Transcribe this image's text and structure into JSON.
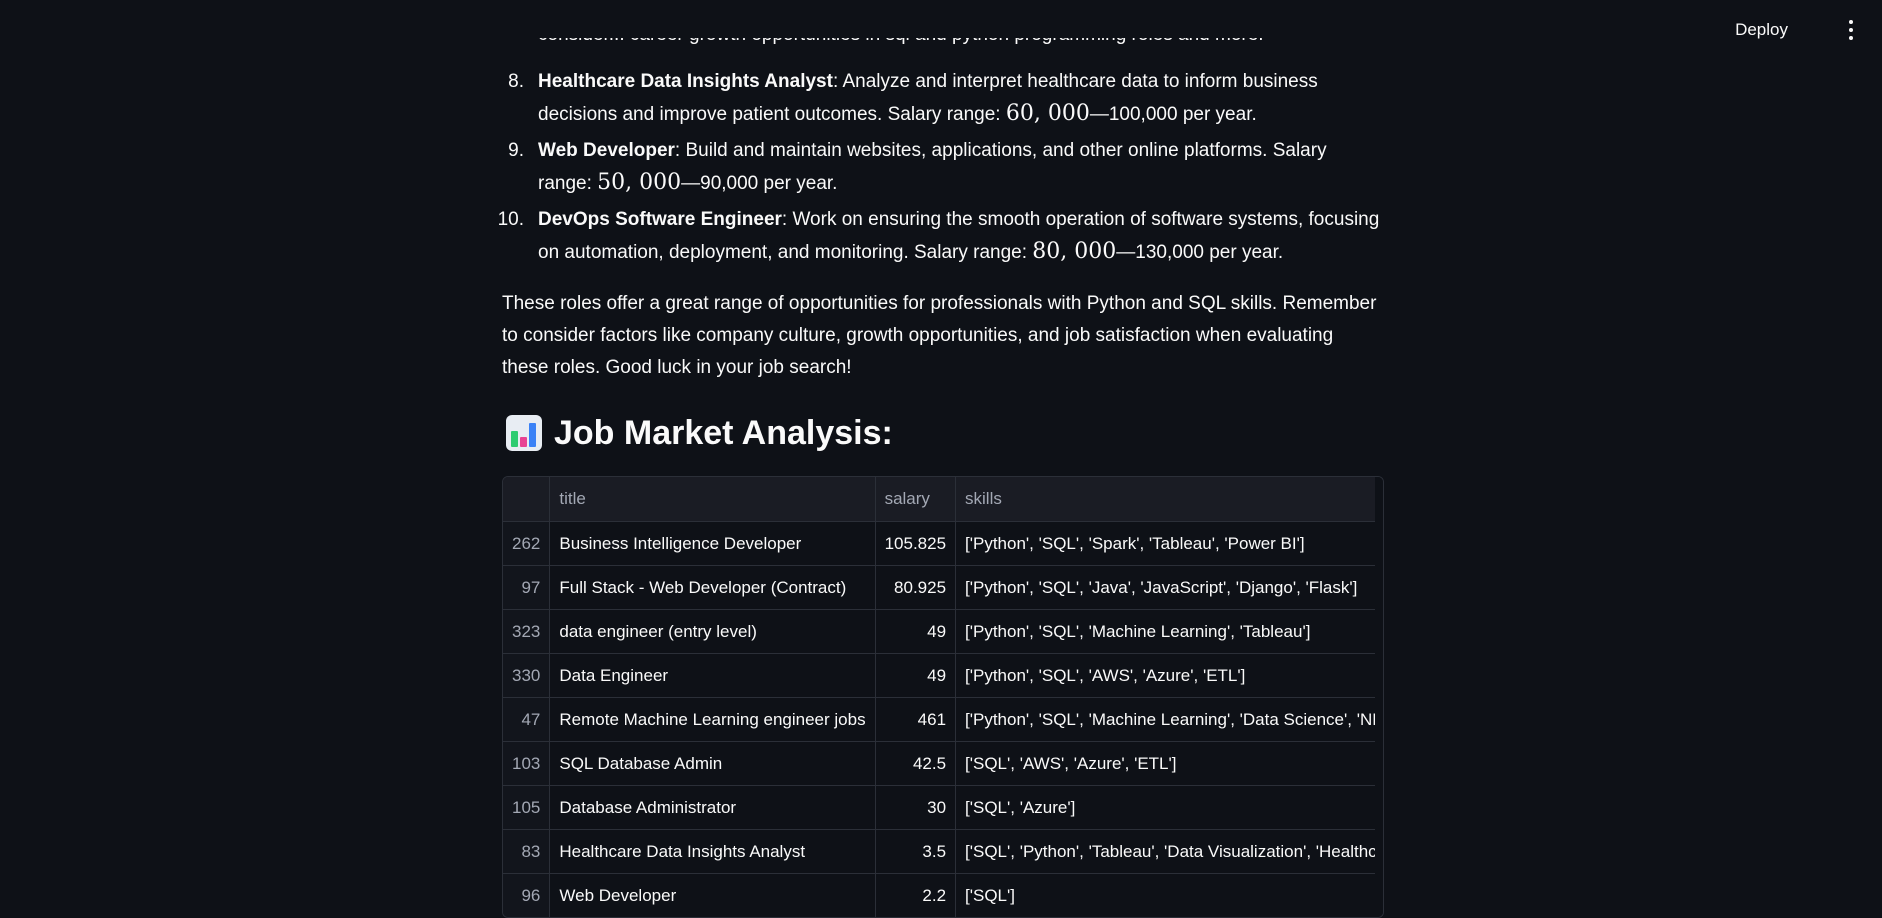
{
  "header": {
    "deploy_label": "Deploy"
  },
  "intro_cutoff_text": "consider... career growth opportunities in sql and python programming roles and more.",
  "roles": [
    {
      "number": "8.",
      "title": "Healthcare Data Insights Analyst",
      "desc": ": Analyze and interpret healthcare data to inform business decisions and improve patient outcomes. Salary range: ",
      "math": "60, 000",
      "tail": "—100,000 per year."
    },
    {
      "number": "9.",
      "title": "Web Developer",
      "desc": ": Build and maintain websites, applications, and other online platforms. Salary range: ",
      "math": "50, 000",
      "tail": "—90,000 per year."
    },
    {
      "number": "10.",
      "title": "DevOps Software Engineer",
      "desc": ": Work on ensuring the smooth operation of software systems, focusing on automation, deployment, and monitoring. Salary range: ",
      "math": "80, 000",
      "tail": "—130,000 per year."
    }
  ],
  "closing_paragraph": "These roles offer a great range of opportunities for professionals with Python and SQL skills. Remember to consider factors like company culture, growth opportunities, and job satisfaction when evaluating these roles. Good luck in your job search!",
  "section": {
    "icon": "bar-chart-icon",
    "title": "Job Market Analysis:"
  },
  "table": {
    "columns": [
      "",
      "title",
      "salary",
      "skills"
    ],
    "rows": [
      {
        "index": "262",
        "title": "Business Intelligence Developer",
        "salary": "105.825",
        "skills": "['Python', 'SQL', 'Spark', 'Tableau', 'Power BI']"
      },
      {
        "index": "97",
        "title": "Full Stack - Web Developer (Contract)",
        "salary": "80.925",
        "skills": "['Python', 'SQL', 'Java', 'JavaScript', 'Django', 'Flask']"
      },
      {
        "index": "323",
        "title": "data engineer (entry level)",
        "salary": "49",
        "skills": "['Python', 'SQL', 'Machine Learning', 'Tableau']"
      },
      {
        "index": "330",
        "title": "Data Engineer",
        "salary": "49",
        "skills": "['Python', 'SQL', 'AWS', 'Azure', 'ETL']"
      },
      {
        "index": "47",
        "title": "Remote Machine Learning engineer jobs",
        "salary": "461",
        "skills": "['Python', 'SQL', 'Machine Learning', 'Data Science', 'NLP']"
      },
      {
        "index": "103",
        "title": "SQL Database Admin",
        "salary": "42.5",
        "skills": "['SQL', 'AWS', 'Azure', 'ETL']"
      },
      {
        "index": "105",
        "title": "Database Administrator",
        "salary": "30",
        "skills": "['SQL', 'Azure']"
      },
      {
        "index": "83",
        "title": "Healthcare Data Insights Analyst",
        "salary": "3.5",
        "skills": "['SQL', 'Python', 'Tableau', 'Data Visualization', 'Healthcare']"
      },
      {
        "index": "96",
        "title": "Web Developer",
        "salary": "2.2",
        "skills": "['SQL']"
      }
    ]
  },
  "colors": {
    "background": "#0e1117",
    "text": "#fafafa",
    "header_bg": "#1a1c24",
    "border": "#2b2f38",
    "muted": "#a3a8b4"
  }
}
